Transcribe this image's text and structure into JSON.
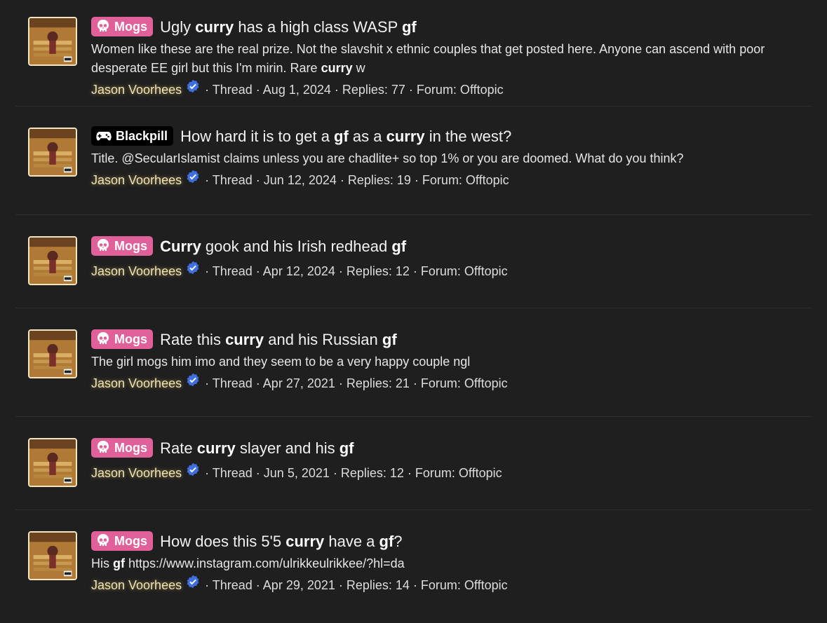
{
  "colors": {
    "background": "#1f1f1f",
    "mogs_prefix": "#e0609a",
    "blackpill_prefix": "#000000",
    "username": "#f0e3b3",
    "verified": "#3d6fe0"
  },
  "results": [
    {
      "prefix": {
        "label": "Mogs",
        "icon": "skull-icon",
        "style": "mogs"
      },
      "title": [
        {
          "t": "Ugly ",
          "b": false
        },
        {
          "t": "curry",
          "b": true
        },
        {
          "t": " has a high class WASP ",
          "b": false
        },
        {
          "t": "gf",
          "b": true
        }
      ],
      "snippet": [
        {
          "t": "Women like these are the real prize. Not the slavshit x ethnic couples that get posted here. Anyone can ascend with poor desperate EE girl but this I'm mirin. Rare ",
          "b": false
        },
        {
          "t": "curry",
          "b": true
        },
        {
          "t": " w",
          "b": false
        }
      ],
      "user": "Jason Voorhees",
      "meta": "Thread · Aug 1, 2024 · Replies: 77 · Forum: Offtopic"
    },
    {
      "prefix": {
        "label": "Blackpill",
        "icon": "gamepad-icon",
        "style": "blackpill"
      },
      "title": [
        {
          "t": "How hard it is to get a ",
          "b": false
        },
        {
          "t": "gf",
          "b": true
        },
        {
          "t": " as a ",
          "b": false
        },
        {
          "t": "curry",
          "b": true
        },
        {
          "t": " in the west?",
          "b": false
        }
      ],
      "snippet": [
        {
          "t": "Title. @SecularIslamist claims unless you are chadlite+ so top 1% or you are doomed. What do you think?",
          "b": false
        }
      ],
      "user": "Jason Voorhees",
      "meta": "Thread · Jun 12, 2024 · Replies: 19 · Forum: Offtopic"
    },
    {
      "prefix": {
        "label": "Mogs",
        "icon": "skull-icon",
        "style": "mogs"
      },
      "title": [
        {
          "t": "Curry",
          "b": true
        },
        {
          "t": " gook and his Irish redhead ",
          "b": false
        },
        {
          "t": "gf",
          "b": true
        }
      ],
      "snippet": [],
      "user": "Jason Voorhees",
      "meta": "Thread · Apr 12, 2024 · Replies: 12 · Forum: Offtopic"
    },
    {
      "prefix": {
        "label": "Mogs",
        "icon": "skull-icon",
        "style": "mogs"
      },
      "title": [
        {
          "t": "Rate this ",
          "b": false
        },
        {
          "t": "curry",
          "b": true
        },
        {
          "t": " and his Russian ",
          "b": false
        },
        {
          "t": "gf",
          "b": true
        }
      ],
      "snippet": [
        {
          "t": "The girl mogs him imo and they seem to be a very happy couple ngl",
          "b": false
        }
      ],
      "user": "Jason Voorhees",
      "meta": "Thread · Apr 27, 2021 · Replies: 21 · Forum: Offtopic"
    },
    {
      "prefix": {
        "label": "Mogs",
        "icon": "skull-icon",
        "style": "mogs"
      },
      "title": [
        {
          "t": "Rate ",
          "b": false
        },
        {
          "t": "curry",
          "b": true
        },
        {
          "t": " slayer and his ",
          "b": false
        },
        {
          "t": "gf",
          "b": true
        }
      ],
      "snippet": [],
      "user": "Jason Voorhees",
      "meta": "Thread · Jun 5, 2021 · Replies: 12 · Forum: Offtopic"
    },
    {
      "prefix": {
        "label": "Mogs",
        "icon": "skull-icon",
        "style": "mogs"
      },
      "title": [
        {
          "t": "How does this 5'5 ",
          "b": false
        },
        {
          "t": "curry",
          "b": true
        },
        {
          "t": " have a ",
          "b": false
        },
        {
          "t": "gf",
          "b": true
        },
        {
          "t": "?",
          "b": false
        }
      ],
      "snippet": [
        {
          "t": "His ",
          "b": false
        },
        {
          "t": "gf",
          "b": true
        },
        {
          "t": " https://www.instagram.com/ulrikkeulrikkee/?hl=da",
          "b": false
        }
      ],
      "user": "Jason Voorhees",
      "meta": "Thread · Apr 29, 2021 · Replies: 14 · Forum: Offtopic"
    }
  ]
}
